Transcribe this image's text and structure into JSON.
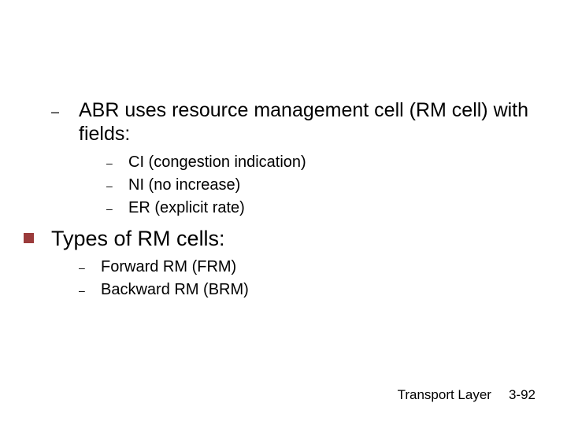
{
  "main": {
    "item1": "ABR uses resource management cell (RM cell) with fields:",
    "sub1": [
      "CI (congestion indication)",
      "NI (no increase)",
      "ER (explicit rate)"
    ],
    "section2": "Types of RM cells:",
    "sub2": [
      "Forward RM (FRM)",
      "Backward RM (BRM)"
    ]
  },
  "footer": {
    "label": "Transport Layer",
    "page": "3-92"
  }
}
